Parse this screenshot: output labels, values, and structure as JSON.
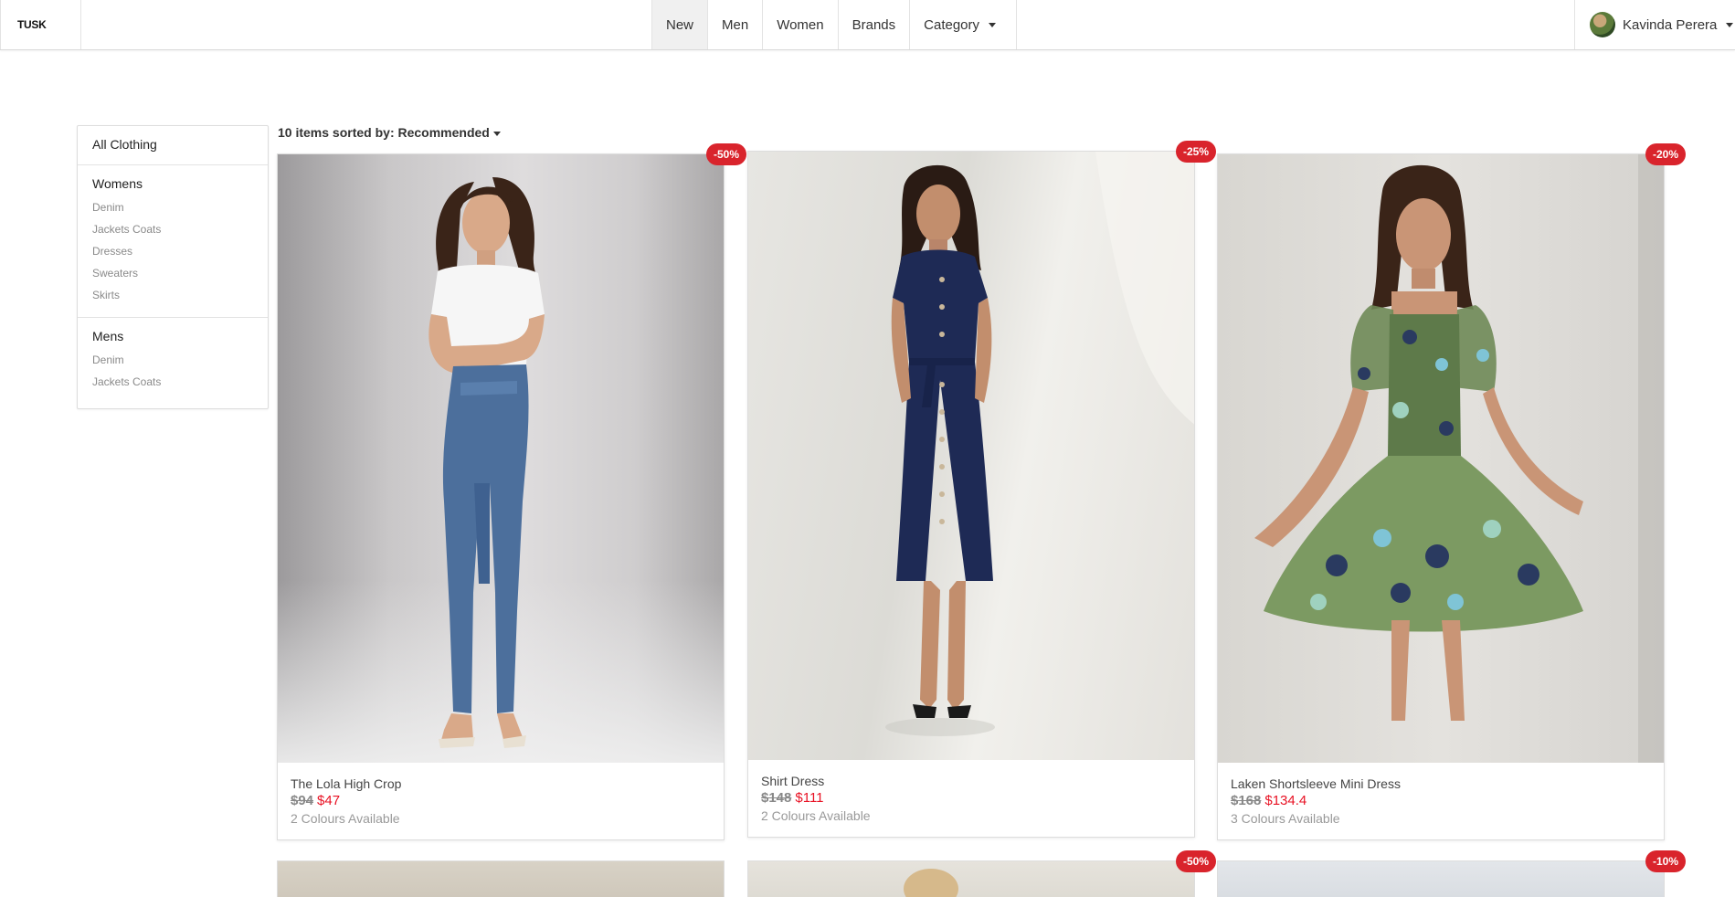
{
  "brand": {
    "logo_text": "TUSK"
  },
  "nav": {
    "items": [
      {
        "label": "New",
        "active": true
      },
      {
        "label": "Men"
      },
      {
        "label": "Women"
      },
      {
        "label": "Brands"
      },
      {
        "label": "Category",
        "dropdown": true
      }
    ]
  },
  "user": {
    "name": "Kavinda Perera"
  },
  "sidebar": {
    "all_label": "All Clothing",
    "sections": [
      {
        "title": "Womens",
        "links": [
          "Denim",
          "Jackets Coats",
          "Dresses",
          "Sweaters",
          "Skirts"
        ]
      },
      {
        "title": "Mens",
        "links": [
          "Denim",
          "Jackets Coats"
        ]
      }
    ]
  },
  "listing": {
    "count_text": "10 items sorted by:",
    "sort_value": "Recommended"
  },
  "products": [
    {
      "name": "The Lola High Crop",
      "old_price": "$94",
      "new_price": "$47",
      "colours": "2 Colours Available",
      "discount": "-50%"
    },
    {
      "name": "Shirt Dress",
      "old_price": "$148",
      "new_price": "$111",
      "colours": "2 Colours Available",
      "discount": "-25%"
    },
    {
      "name": "Laken Shortsleeve Mini Dress",
      "old_price": "$168",
      "new_price": "$134.4",
      "colours": "3 Colours Available",
      "discount": "-20%"
    },
    {
      "discount": ""
    },
    {
      "discount": "-50%"
    },
    {
      "discount": "-10%"
    }
  ],
  "colors": {
    "sale": "#e81123",
    "badge": "#d9242c"
  }
}
